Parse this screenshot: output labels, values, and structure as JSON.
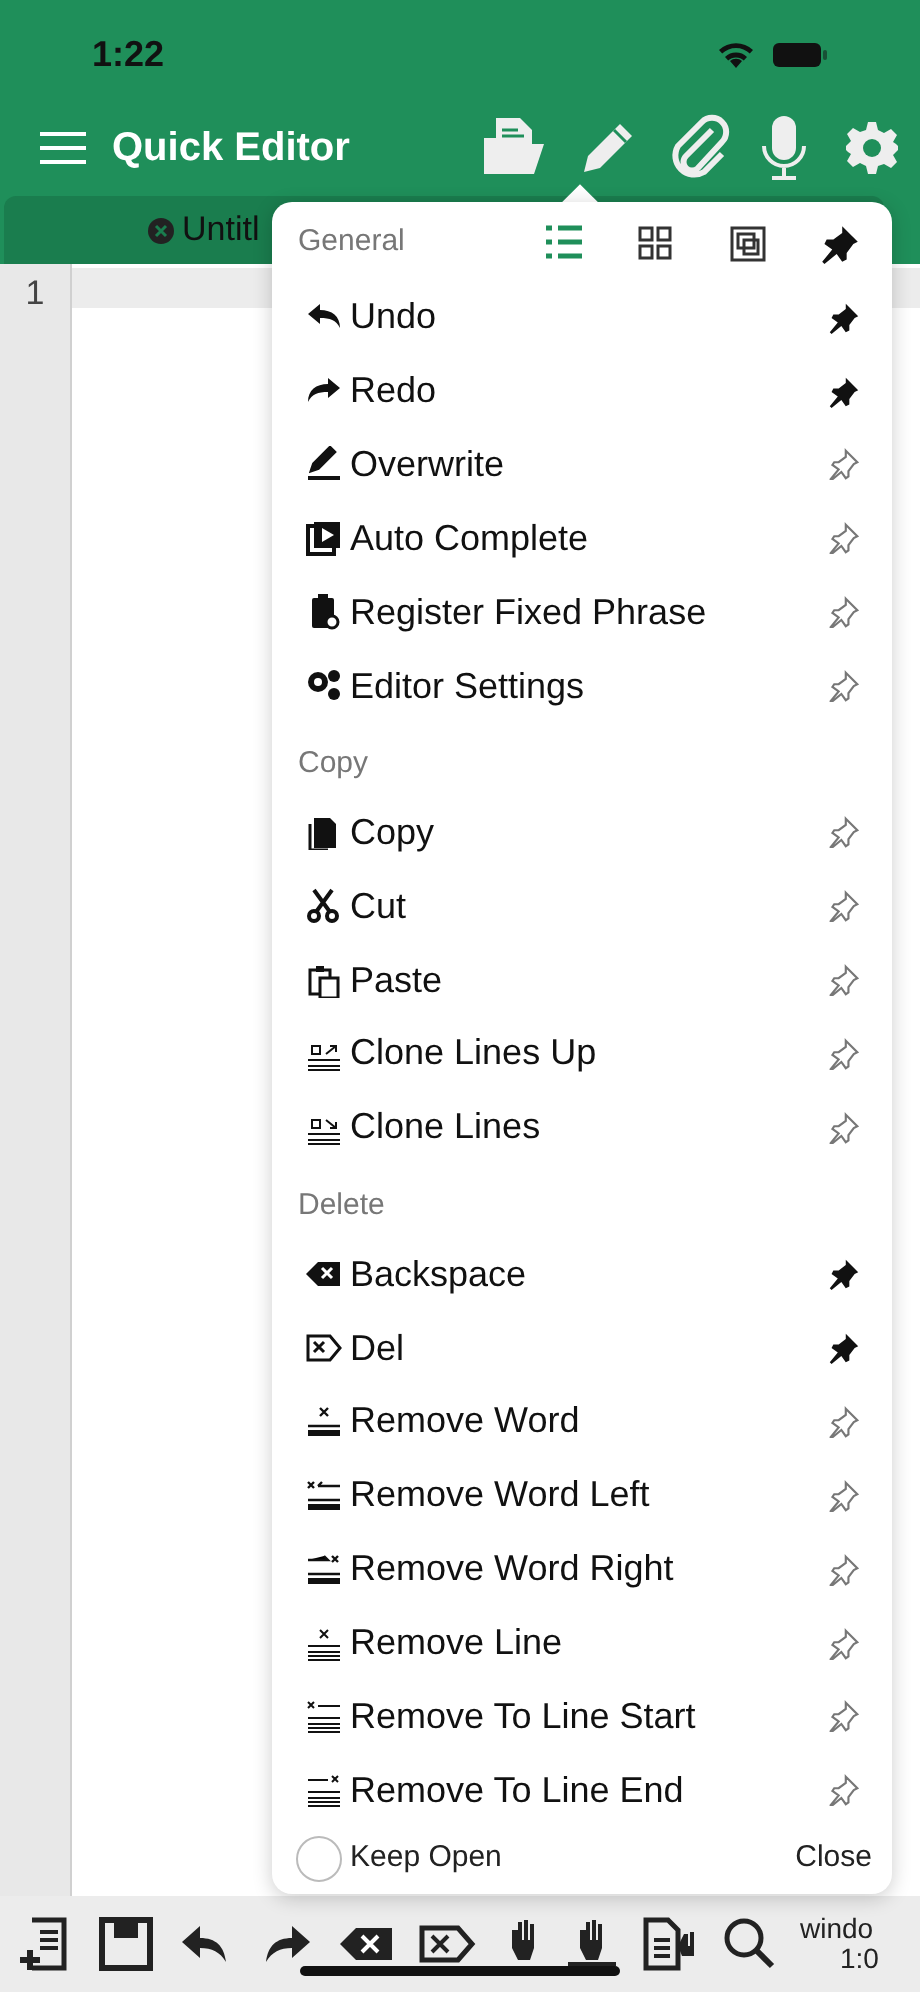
{
  "status_bar": {
    "time": "1:22"
  },
  "app_bar": {
    "title": "Quick Editor"
  },
  "tab": {
    "label": "Untitl"
  },
  "editor": {
    "line_numbers": [
      "1"
    ]
  },
  "menu": {
    "view_modes": [
      {
        "selected": true
      },
      {
        "selected": false
      },
      {
        "selected": false
      }
    ],
    "pinned": true,
    "sections": [
      {
        "title": "General",
        "items": [
          {
            "label": "Undo",
            "pinned": true
          },
          {
            "label": "Redo",
            "pinned": true
          },
          {
            "label": "Overwrite",
            "pinned": false
          },
          {
            "label": "Auto Complete",
            "pinned": false
          },
          {
            "label": "Register Fixed Phrase",
            "pinned": false
          },
          {
            "label": "Editor Settings",
            "pinned": false
          }
        ]
      },
      {
        "title": "Copy",
        "items": [
          {
            "label": "Copy",
            "pinned": false
          },
          {
            "label": "Cut",
            "pinned": false
          },
          {
            "label": "Paste",
            "pinned": false
          },
          {
            "label": "Clone Lines Up",
            "pinned": false
          },
          {
            "label": "Clone Lines",
            "pinned": false
          }
        ]
      },
      {
        "title": "Delete",
        "items": [
          {
            "label": "Backspace",
            "pinned": true
          },
          {
            "label": "Del",
            "pinned": true
          },
          {
            "label": "Remove Word",
            "pinned": false
          },
          {
            "label": "Remove Word Left",
            "pinned": false
          },
          {
            "label": "Remove Word Right",
            "pinned": false
          },
          {
            "label": "Remove Line",
            "pinned": false
          },
          {
            "label": "Remove To Line Start",
            "pinned": false
          },
          {
            "label": "Remove To Line End",
            "pinned": false
          }
        ]
      }
    ],
    "keep_open": {
      "label": "Keep Open",
      "checked": false
    },
    "close": "Close"
  },
  "bottom_bar": {
    "mode": "windo",
    "position": "1:0"
  }
}
